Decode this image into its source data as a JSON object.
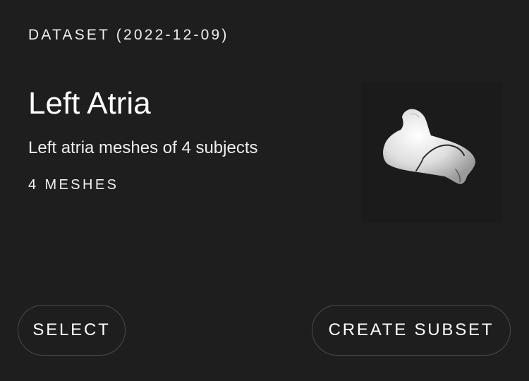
{
  "card": {
    "overline": "DATASET (2022-12-09)",
    "title": "Left Atria",
    "description": "Left atria meshes of 4 subjects",
    "mesh_count": "4 MESHES",
    "thumbnail_icon": "left-atrium-mesh-icon"
  },
  "actions": {
    "select_label": "SELECT",
    "create_subset_label": "CREATE SUBSET"
  },
  "colors": {
    "background": "#1e1e1e",
    "text": "#ffffff",
    "button_border": "#4a4a4a",
    "thumbnail_background": "#1b1b1b"
  }
}
